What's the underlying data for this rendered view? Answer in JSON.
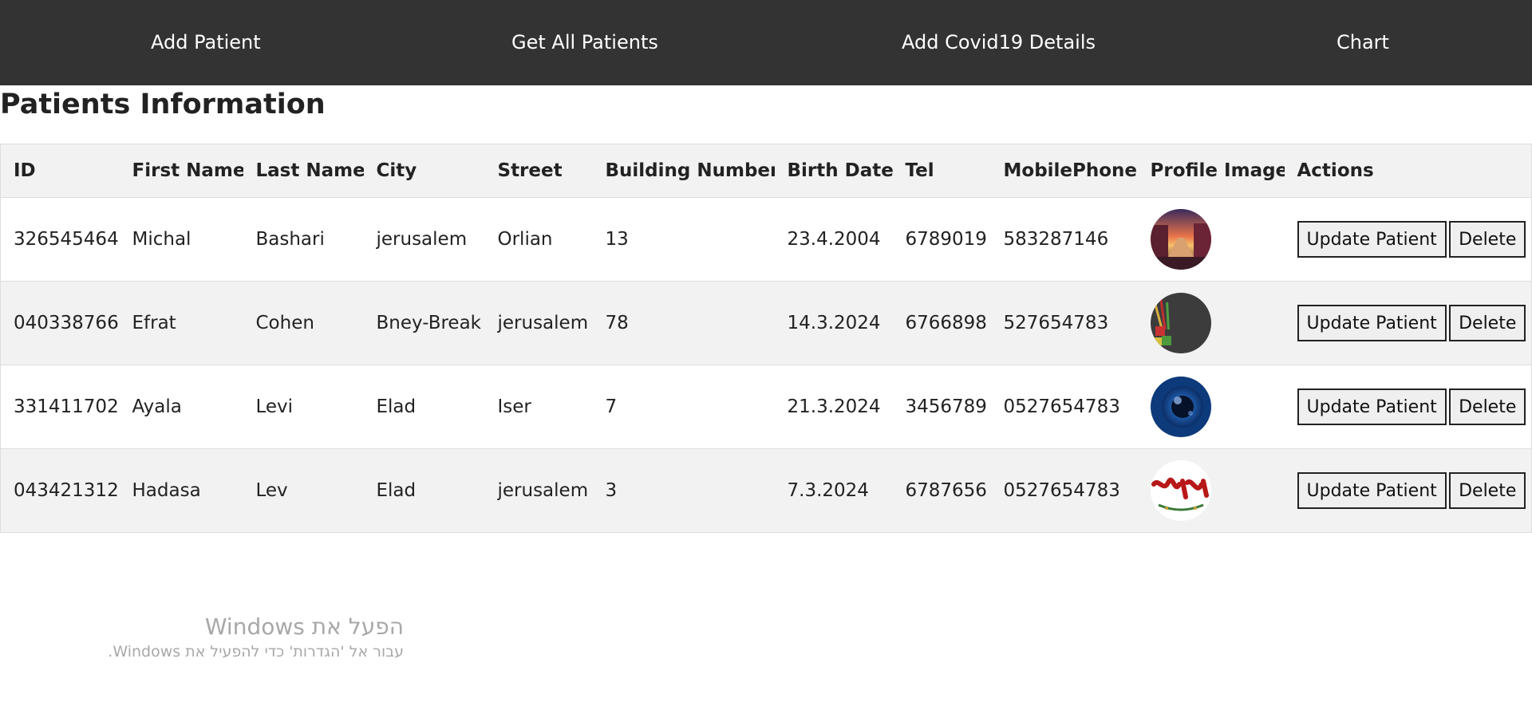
{
  "nav": {
    "add_patient": "Add Patient",
    "get_all_patients": "Get All Patients",
    "add_covid_details": "Add Covid19 Details",
    "chart": "Chart"
  },
  "page_title": "Patients Information",
  "table": {
    "headers": [
      "ID",
      "First Name",
      "Last Name",
      "City",
      "Street",
      "Building Number",
      "Birth Date",
      "Tel",
      "MobilePhone",
      "Profile Image",
      "Actions"
    ],
    "rows": [
      {
        "id": "326545464",
        "first_name": "Michal",
        "last_name": "Bashari",
        "city": "jerusalem",
        "street": "Orlian",
        "building_number": "13",
        "birth_date": "23.4.2004",
        "tel": "6789019",
        "mobile": "583287146"
      },
      {
        "id": "040338766",
        "first_name": "Efrat",
        "last_name": "Cohen",
        "city": "Bney-Break",
        "street": "jerusalem",
        "building_number": "78",
        "birth_date": "14.3.2024",
        "tel": "6766898",
        "mobile": "527654783"
      },
      {
        "id": "331411702",
        "first_name": "Ayala",
        "last_name": "Levi",
        "city": "Elad",
        "street": "Iser",
        "building_number": "7",
        "birth_date": "21.3.2024",
        "tel": "3456789",
        "mobile": "0527654783"
      },
      {
        "id": "043421312",
        "first_name": "Hadasa",
        "last_name": "Lev",
        "city": "Elad",
        "street": "jerusalem",
        "building_number": "3",
        "birth_date": "7.3.2024",
        "tel": "6787656",
        "mobile": "0527654783"
      }
    ],
    "avatar_icons": [
      "sunset-canal-image",
      "chalkboard-blocks-image",
      "camera-lens-image",
      "red-lettering-logo-image"
    ]
  },
  "actions": {
    "update_label": "Update Patient",
    "delete_label": "Delete"
  },
  "watermark": {
    "title": "הפעל את Windows",
    "subtitle": "עבור אל 'הגדרות' כדי להפעיל את Windows."
  },
  "colors": {
    "navbar_bg": "#333333",
    "nav_text": "#ffffff",
    "row_alt_bg": "#f2f2f2",
    "border": "#dddddd"
  }
}
